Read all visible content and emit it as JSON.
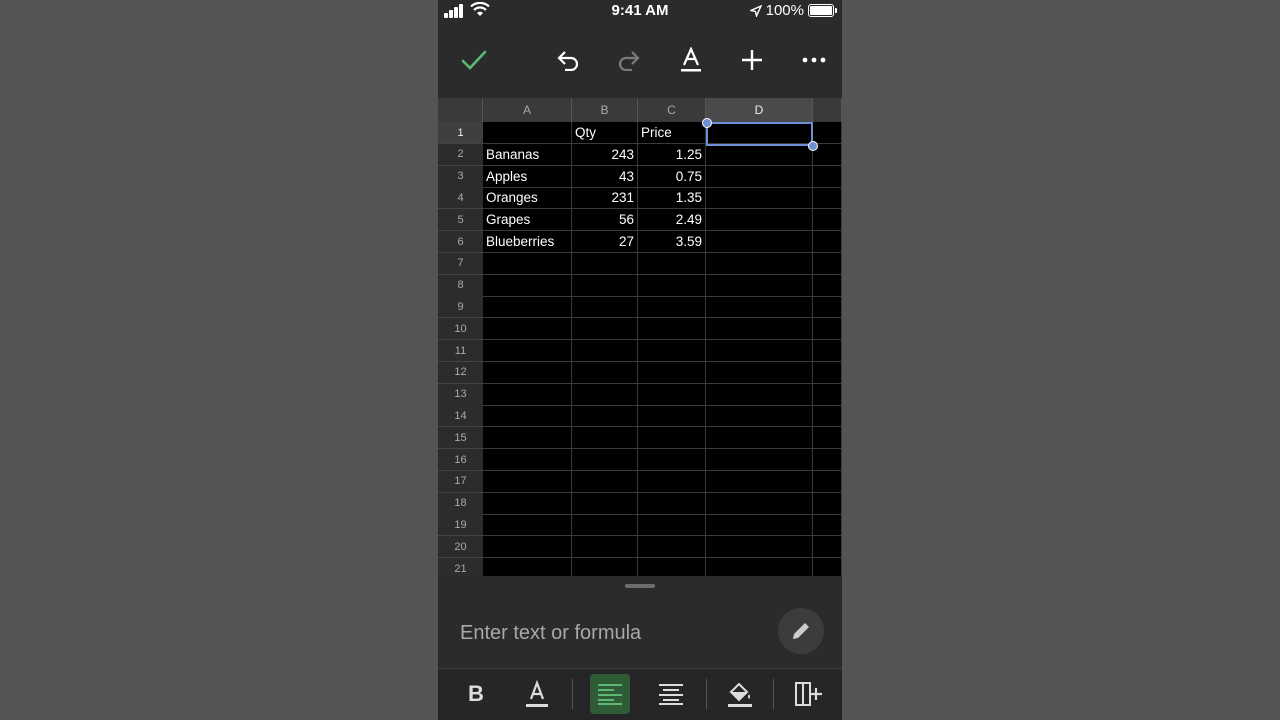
{
  "status_bar": {
    "time": "9:41 AM",
    "battery": "100%"
  },
  "toolbar": {
    "confirm_icon": "checkmark-icon",
    "undo_icon": "undo-icon",
    "redo_icon": "redo-icon",
    "text_format_icon": "text-format-icon",
    "insert_icon": "plus-icon",
    "more_icon": "more-icon"
  },
  "sheet": {
    "columns": [
      "A",
      "B",
      "C",
      "D"
    ],
    "rows": [
      "1",
      "2",
      "3",
      "4",
      "5",
      "6",
      "7",
      "8",
      "9",
      "10",
      "11",
      "12",
      "13",
      "14",
      "15",
      "16",
      "17",
      "18",
      "19",
      "20",
      "21"
    ],
    "header_row": [
      "",
      "Qty",
      "Price",
      ""
    ],
    "data": [
      [
        "Bananas",
        "243",
        "1.25"
      ],
      [
        "Apples",
        "43",
        "0.75"
      ],
      [
        "Oranges",
        "231",
        "1.35"
      ],
      [
        "Grapes",
        "56",
        "2.49"
      ],
      [
        "Blueberries",
        "27",
        "3.59"
      ]
    ],
    "selected_cell": "D1"
  },
  "formula_bar": {
    "placeholder": "Enter text or formula",
    "value": ""
  },
  "format_bar": {
    "bold_label": "B",
    "text_color_label": "A"
  },
  "colors": {
    "accent": "#6c8fd6",
    "check": "#5bb974",
    "active_button": "#2f5b37"
  }
}
